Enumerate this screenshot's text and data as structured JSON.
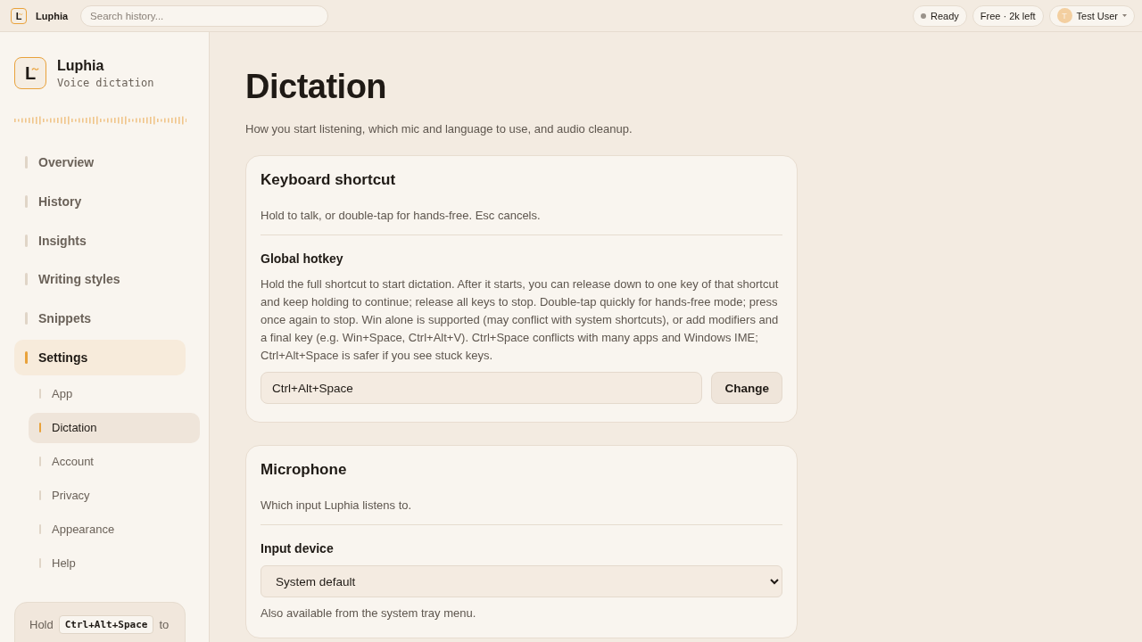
{
  "topbar": {
    "logo_mark": "L",
    "app_name": "Luphia",
    "search": {
      "placeholder": "Search history..."
    },
    "status": "Ready",
    "plan": "Free · 2k left",
    "user": {
      "initial": "T",
      "name": "Test User"
    }
  },
  "sidebar": {
    "brand": {
      "logo_mark": "L",
      "name": "Luphia",
      "tagline": "Voice dictation"
    },
    "items": [
      {
        "label": "Overview",
        "selected": false
      },
      {
        "label": "History",
        "selected": false
      },
      {
        "label": "Insights",
        "selected": false
      },
      {
        "label": "Writing styles",
        "selected": false
      },
      {
        "label": "Snippets",
        "selected": false
      },
      {
        "label": "Settings",
        "selected": true,
        "children": [
          {
            "label": "App",
            "selected": false
          },
          {
            "label": "Dictation",
            "selected": true
          },
          {
            "label": "Account",
            "selected": false
          },
          {
            "label": "Privacy",
            "selected": false
          },
          {
            "label": "Appearance",
            "selected": false
          },
          {
            "label": "Help",
            "selected": false
          }
        ]
      }
    ],
    "hint": {
      "before": "Hold",
      "key": "Ctrl+Alt+Space",
      "after": "to"
    }
  },
  "page": {
    "title": "Dictation",
    "subtitle": "How you start listening, which mic and language to use, and audio cleanup.",
    "cards": [
      {
        "title": "Keyboard shortcut",
        "description": "Hold to talk, or double-tap for hands-free. Esc cancels.",
        "fields": [
          {
            "kind": "hotkey",
            "label": "Global hotkey",
            "help": "Hold the full shortcut to start dictation. After it starts, you can release down to one key of that shortcut and keep holding to continue; release all keys to stop. Double-tap quickly for hands-free mode; press once again to stop. Win alone is supported (may conflict with system shortcuts), or add modifiers and a final key (e.g. Win+Space, Ctrl+Alt+V). Ctrl+Space conflicts with many apps and Windows IME; Ctrl+Alt+Space is safer if you see stuck keys.",
            "value": "Ctrl+Alt+Space",
            "button": "Change"
          }
        ]
      },
      {
        "title": "Microphone",
        "description": "Which input Luphia listens to.",
        "fields": [
          {
            "kind": "select",
            "label": "Input device",
            "value": "System default",
            "note": "Also available from the system tray menu."
          }
        ]
      }
    ]
  }
}
